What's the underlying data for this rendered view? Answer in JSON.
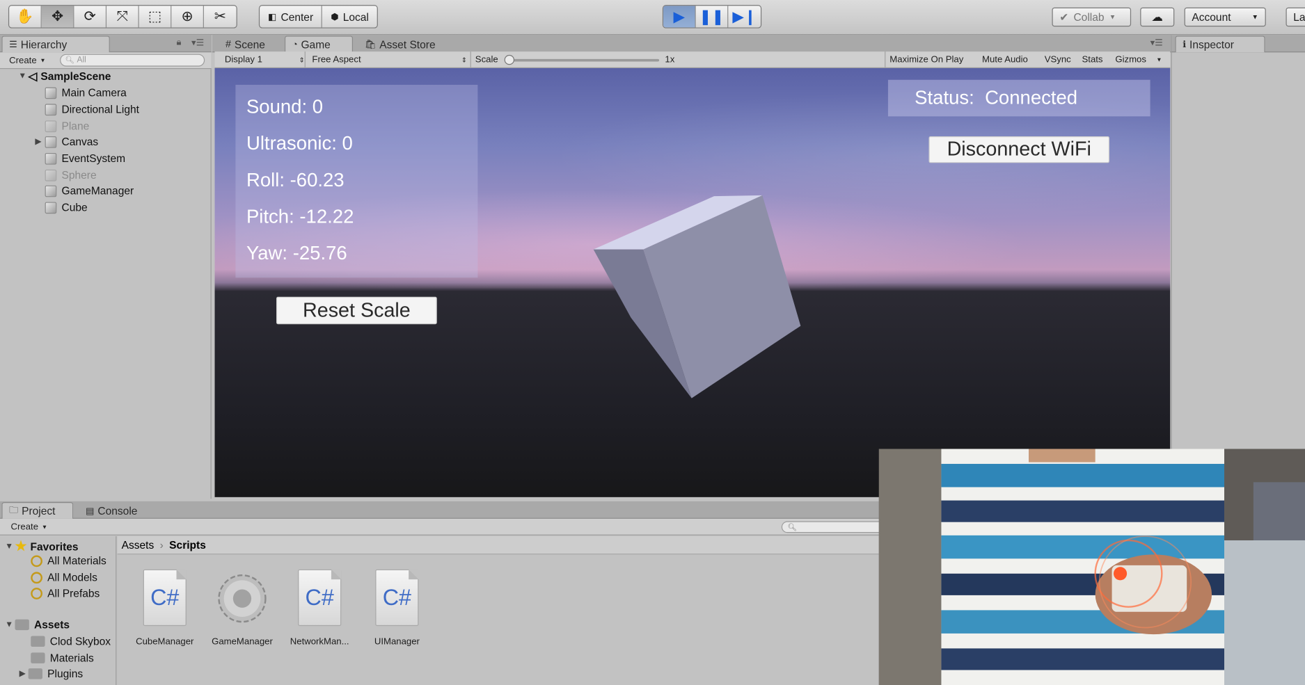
{
  "toolbar": {
    "pivot_label": "Center",
    "space_label": "Local",
    "collab_label": "Collab",
    "account_label": "Account",
    "layers_label": "La"
  },
  "hierarchy": {
    "tab_label": "Hierarchy",
    "create_label": "Create",
    "search_placeholder": "All",
    "scene_name": "SampleScene",
    "items": [
      {
        "label": "Main Camera"
      },
      {
        "label": "Directional Light"
      },
      {
        "label": "Plane"
      },
      {
        "label": "Canvas"
      },
      {
        "label": "EventSystem"
      },
      {
        "label": "Sphere"
      },
      {
        "label": "GameManager"
      },
      {
        "label": "Cube"
      }
    ]
  },
  "center_tabs": {
    "scene": "Scene",
    "game": "Game",
    "asset_store": "Asset Store"
  },
  "game_toolbar": {
    "display": "Display 1",
    "aspect": "Free Aspect",
    "scale_label": "Scale",
    "scale_value": "1x",
    "maximize": "Maximize On Play",
    "mute": "Mute Audio",
    "vsync": "VSync",
    "stats": "Stats",
    "gizmos": "Gizmos"
  },
  "game_view": {
    "sensor_lines": [
      "Sound: 0",
      "Ultrasonic: 0",
      "Roll: -60.23",
      "Pitch: -12.22",
      "Yaw: -25.76"
    ],
    "status_text": "Status:  Connected",
    "disconnect_label": "Disconnect WiFi",
    "reset_label": "Reset Scale"
  },
  "inspector": {
    "tab_label": "Inspector"
  },
  "bottom_tabs": {
    "project": "Project",
    "console": "Console"
  },
  "project": {
    "create_label": "Create",
    "favorites_label": "Favorites",
    "favorites": [
      "All Materials",
      "All Models",
      "All Prefabs"
    ],
    "assets_label": "Assets",
    "folders": [
      "Clod Skybox",
      "Materials",
      "Plugins"
    ],
    "breadcrumb_root": "Assets",
    "breadcrumb_current": "Scripts",
    "files": [
      {
        "name": "CubeManager",
        "kind": "C#"
      },
      {
        "name": "GameManager",
        "kind": "gear"
      },
      {
        "name": "NetworkMan...",
        "kind": "C#"
      },
      {
        "name": "UIManager",
        "kind": "C#"
      }
    ]
  }
}
